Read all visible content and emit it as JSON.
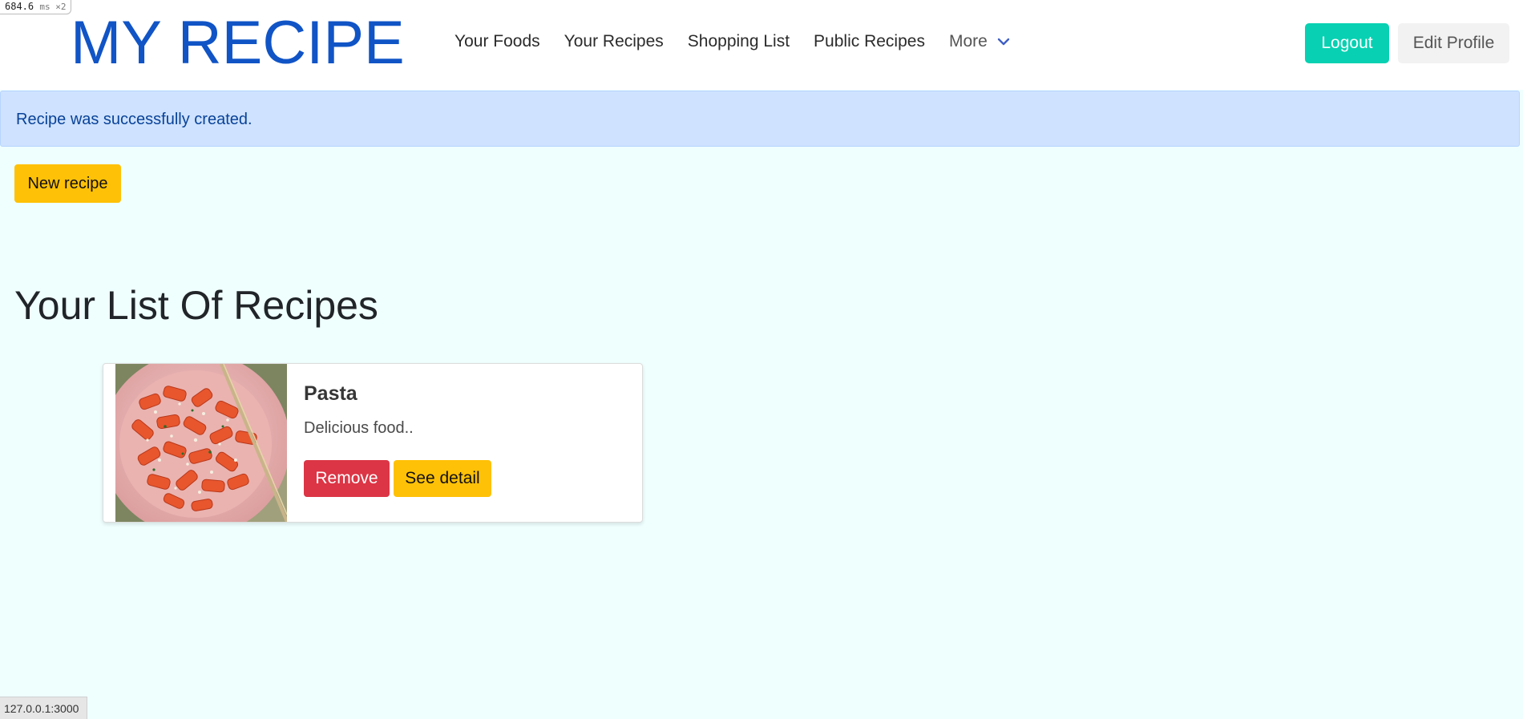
{
  "perf_badge": {
    "value": "684.6",
    "unit": "ms ×2"
  },
  "navbar": {
    "brand": "MY RECIPE",
    "links": [
      {
        "label": "Your Foods"
      },
      {
        "label": "Your Recipes"
      },
      {
        "label": "Shopping List"
      },
      {
        "label": "Public Recipes"
      }
    ],
    "more_label": "More",
    "logout_label": "Logout",
    "edit_profile_label": "Edit Profile"
  },
  "alert": {
    "message": "Recipe was successfully created."
  },
  "new_recipe_label": "New recipe",
  "section_title": "Your List Of Recipes",
  "recipes": [
    {
      "name": "Pasta",
      "description": "Delicious food..",
      "remove_label": "Remove",
      "detail_label": "See detail"
    }
  ],
  "status_bar": {
    "url": "127.0.0.1:3000"
  },
  "colors": {
    "brand": "#1054c6",
    "logout": "#07d1b2",
    "alert_bg": "#cfe2ff",
    "warning": "#ffc107",
    "danger": "#dc3545",
    "page_bg": "#effffe"
  }
}
